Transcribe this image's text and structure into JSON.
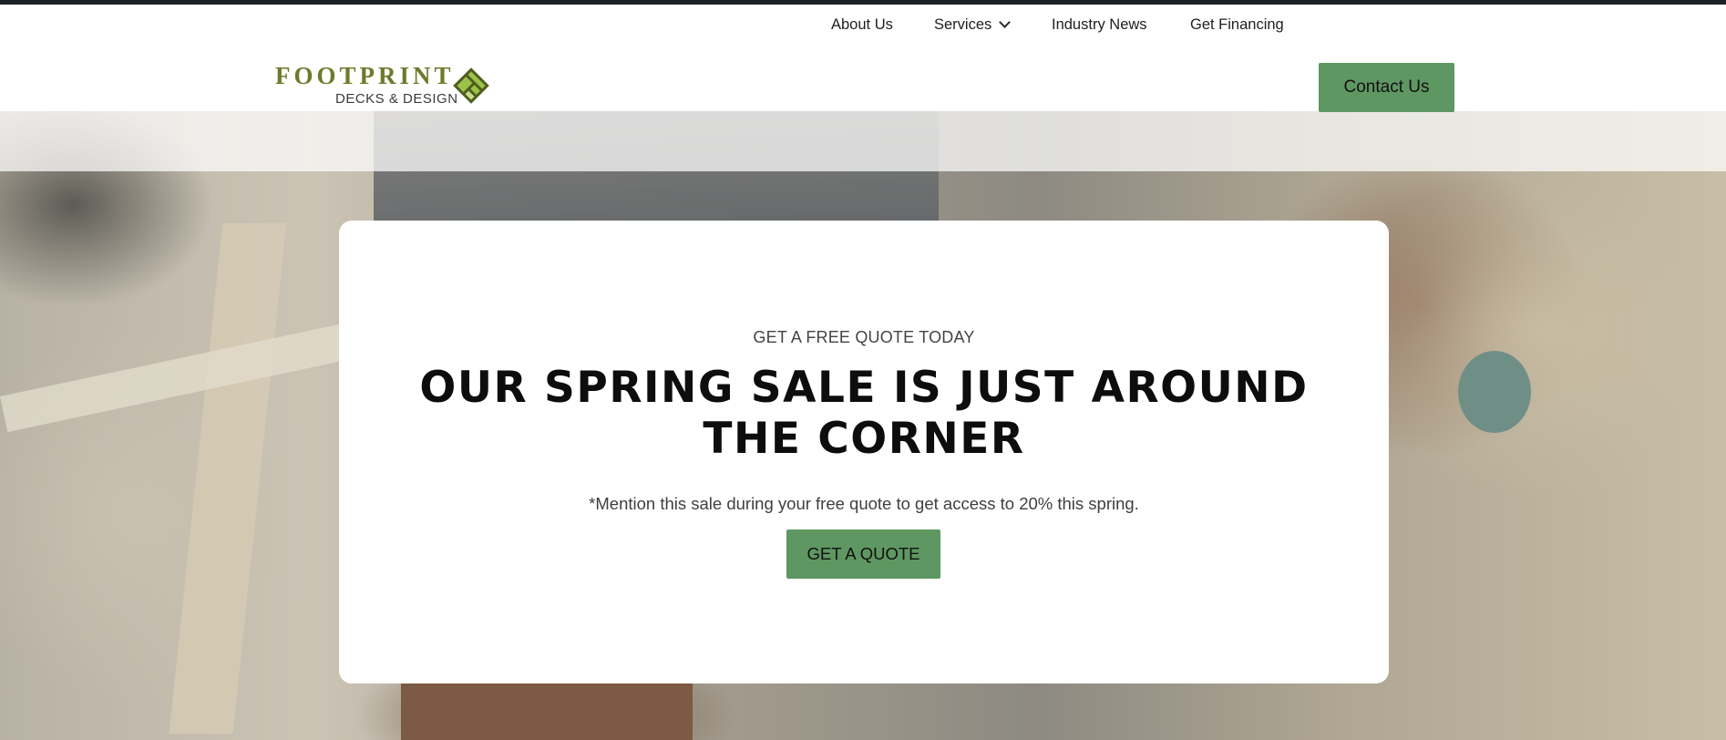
{
  "brand": {
    "name": "FOOTPRINT",
    "tagline": "DECKS & DESIGN",
    "green": "#6e7a2a",
    "mark_light": "#9cc24a",
    "mark_dark": "#4f5e1f"
  },
  "nav": {
    "items": [
      {
        "label": "About Us"
      },
      {
        "label": "Services",
        "has_dropdown": true
      },
      {
        "label": "Industry News"
      },
      {
        "label": "Get Financing"
      }
    ],
    "cta_label": "Contact Us"
  },
  "hero": {
    "eyebrow": "GET A FREE QUOTE TODAY",
    "headline": "OUR SPRING SALE IS JUST AROUND THE CORNER",
    "subtext": "*Mention this sale during your free quote to get access to 20% this spring.",
    "button_label": "GET A QUOTE"
  },
  "colors": {
    "accent": "#5e9762",
    "topbar": "#1d2327"
  }
}
